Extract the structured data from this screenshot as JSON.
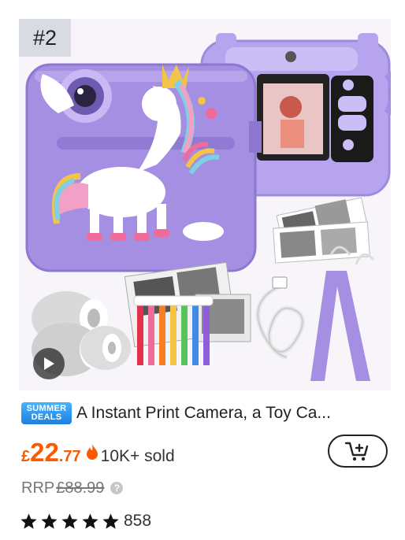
{
  "product": {
    "rank": "#2",
    "badge": {
      "line1": "SUMMER",
      "line2": "DEALS"
    },
    "title": "A Instant Print Camera, a Toy Ca...",
    "price": {
      "currency": "£",
      "whole": "22",
      "decimal": ".77"
    },
    "sold": "10K+ sold",
    "rrp_label": "RRP",
    "rrp_price": "£88.99",
    "info_glyph": "?",
    "rating": 5,
    "review_count": "858"
  },
  "colors": {
    "price": "#fb5a00",
    "camera_purple": "#a58fe3",
    "badge_blue": "#1e7fe0"
  },
  "icons": {
    "flame": "flame-icon",
    "cart": "add-to-cart-icon",
    "star": "star-icon",
    "play": "play-icon",
    "info": "info-icon"
  }
}
